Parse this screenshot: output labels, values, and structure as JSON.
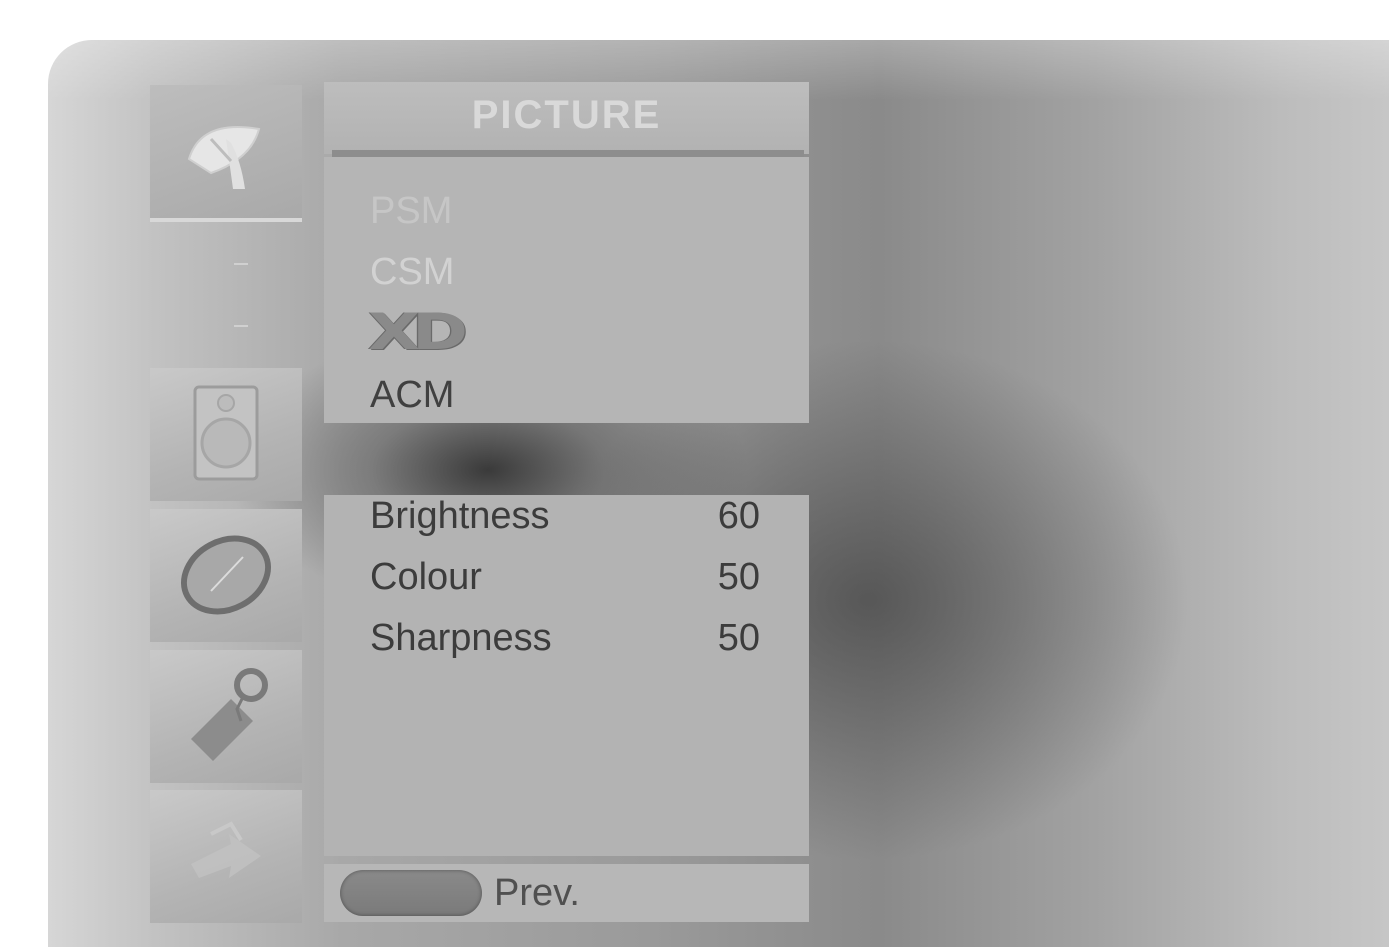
{
  "menu": {
    "title": "PICTURE",
    "modes": [
      {
        "label": "PSM",
        "state": "faint"
      },
      {
        "label": "CSM",
        "state": "dim"
      },
      {
        "label": "XD",
        "state": "logo"
      },
      {
        "label": "ACM",
        "state": "normal"
      }
    ],
    "adjustments": [
      {
        "label": "Brightness",
        "value": "60"
      },
      {
        "label": "Colour",
        "value": "50"
      },
      {
        "label": "Sharpness",
        "value": "50"
      }
    ],
    "footer": {
      "prev_label": "Prev."
    }
  },
  "icons": [
    {
      "name": "satellite-dish-icon",
      "selected": true
    },
    {
      "name": "speaker-icon",
      "selected": false
    },
    {
      "name": "clock-icon",
      "selected": false
    },
    {
      "name": "key-tag-icon",
      "selected": false
    },
    {
      "name": "arrows-icon",
      "selected": false
    }
  ],
  "colors": {
    "panel": "#b5b5b5",
    "text": "#404040",
    "button": "#808080"
  }
}
